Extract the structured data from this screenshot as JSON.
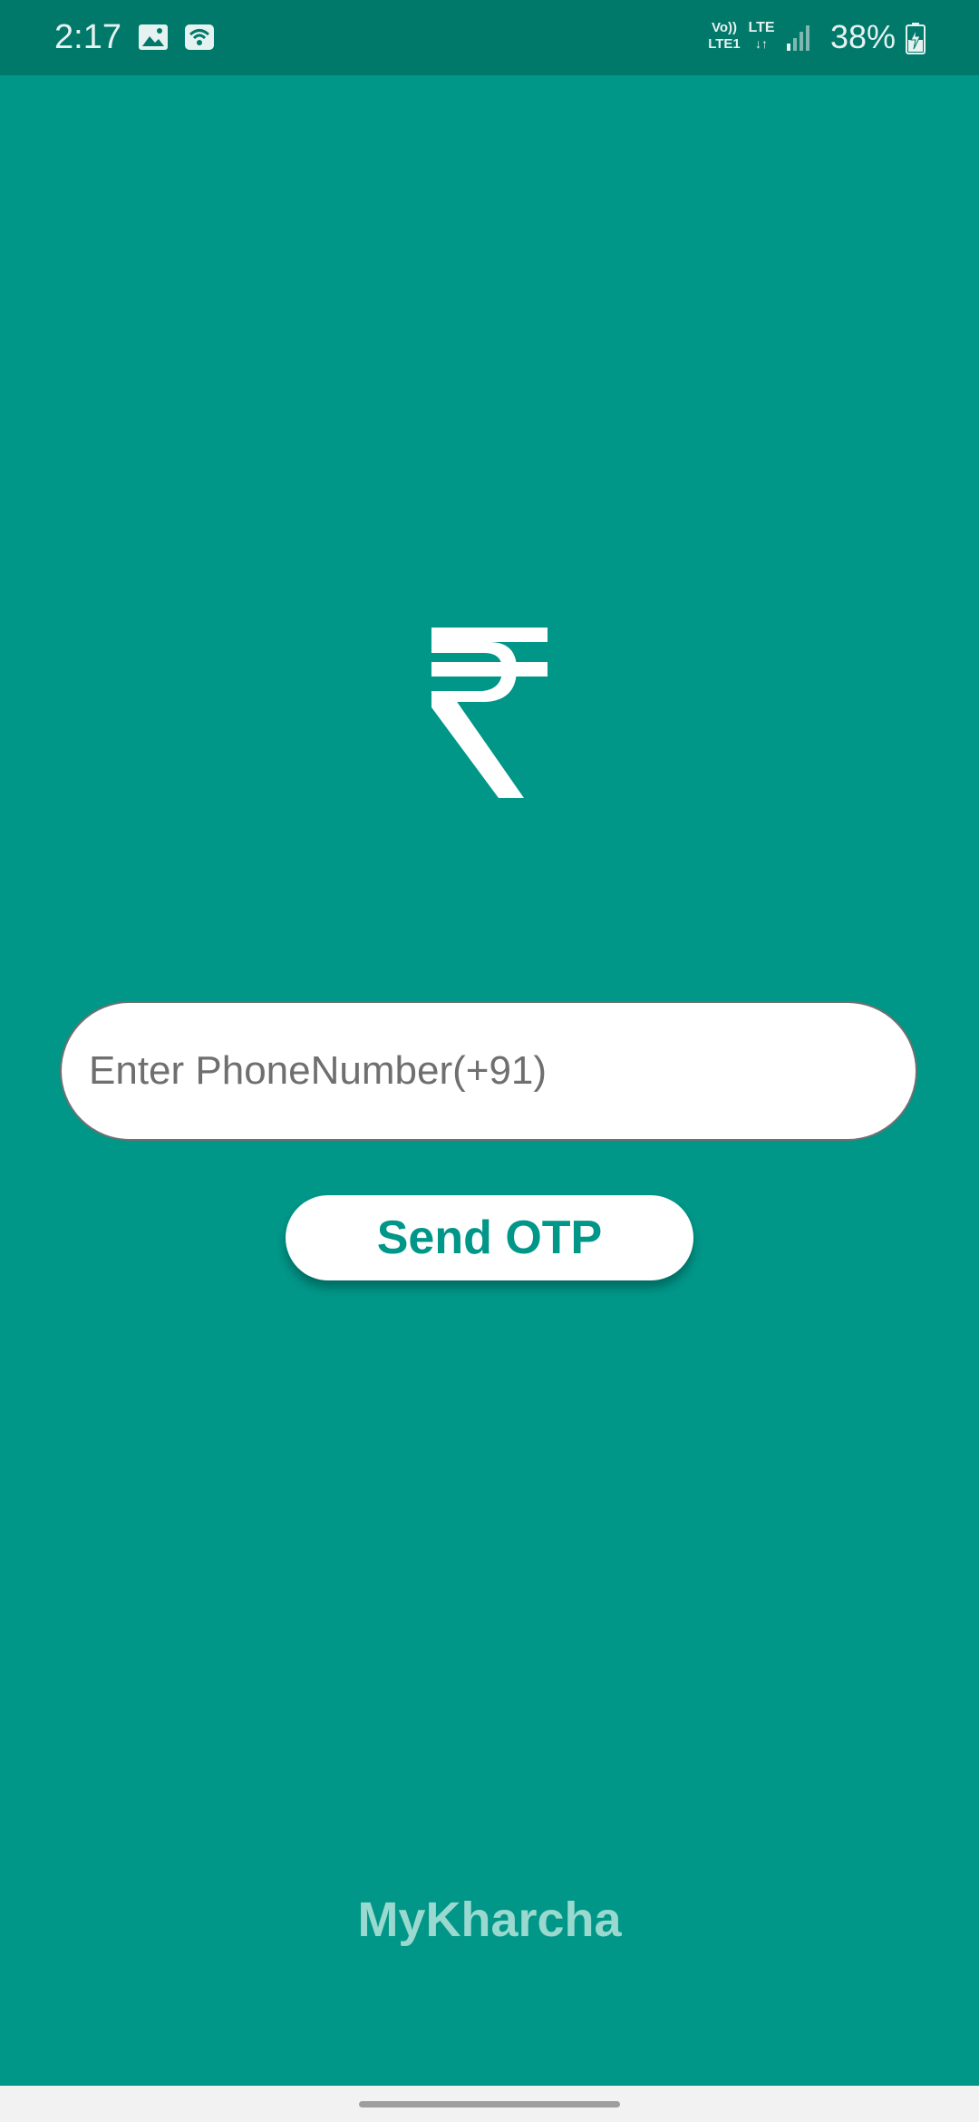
{
  "status_bar": {
    "time": "2:17",
    "volte_label_top": "Vo))",
    "volte_label_bottom": "LTE1",
    "lte_label": "LTE",
    "battery_percent": "38%",
    "icons": [
      "gallery-icon",
      "wifi-icon",
      "signal-icon",
      "battery-charging-icon"
    ]
  },
  "logo": {
    "icon": "rupee-icon"
  },
  "phone_input": {
    "value": "",
    "placeholder": "Enter PhoneNumber(+91)"
  },
  "send_otp": {
    "label": "Send OTP"
  },
  "app": {
    "name": "MyKharcha"
  },
  "theme": {
    "background": "#009688",
    "status_bar": "#00796b",
    "accent_text": "#009688",
    "app_name_color": "#9ad9cf"
  }
}
